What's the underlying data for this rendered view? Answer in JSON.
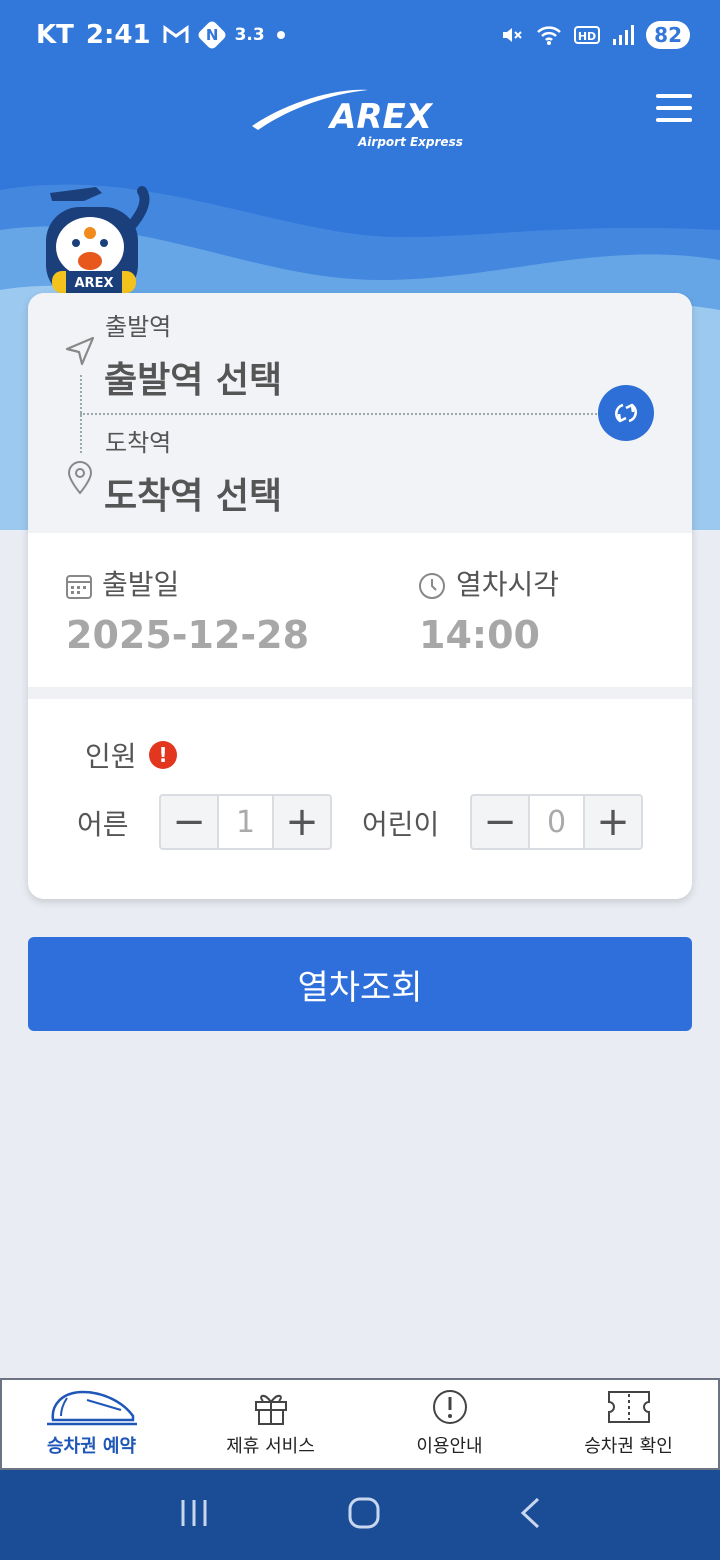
{
  "status_bar": {
    "carrier": "KT",
    "time": "2:41",
    "speed": "3.3",
    "battery": "82"
  },
  "header": {
    "logo_text": "AREX",
    "logo_sub": "Airport Express",
    "mascot_text": "AREX"
  },
  "stations": {
    "departure_label": "출발역",
    "departure_value": "출발역 선택",
    "arrival_label": "도착역",
    "arrival_value": "도착역 선택"
  },
  "datetime": {
    "date_label": "출발일",
    "date_value": "2025-12-28",
    "time_label": "열차시각",
    "time_value": "14:00"
  },
  "persons": {
    "label": "인원",
    "warning_icon": "!",
    "adult_label": "어른",
    "adult_count": "1",
    "child_label": "어린이",
    "child_count": "0",
    "minus": "−",
    "plus": "+"
  },
  "search_button": "열차조회",
  "tabs": [
    {
      "label": "승차권 예약",
      "icon": "train-icon",
      "active": true
    },
    {
      "label": "제휴 서비스",
      "icon": "gift-icon",
      "active": false
    },
    {
      "label": "이용안내",
      "icon": "info-icon",
      "active": false
    },
    {
      "label": "승차권 확인",
      "icon": "ticket-icon",
      "active": false
    }
  ],
  "colors": {
    "primary": "#3277da",
    "button": "#2e6fdc",
    "active_tab": "#1e57b8",
    "warning": "#e2361e"
  }
}
